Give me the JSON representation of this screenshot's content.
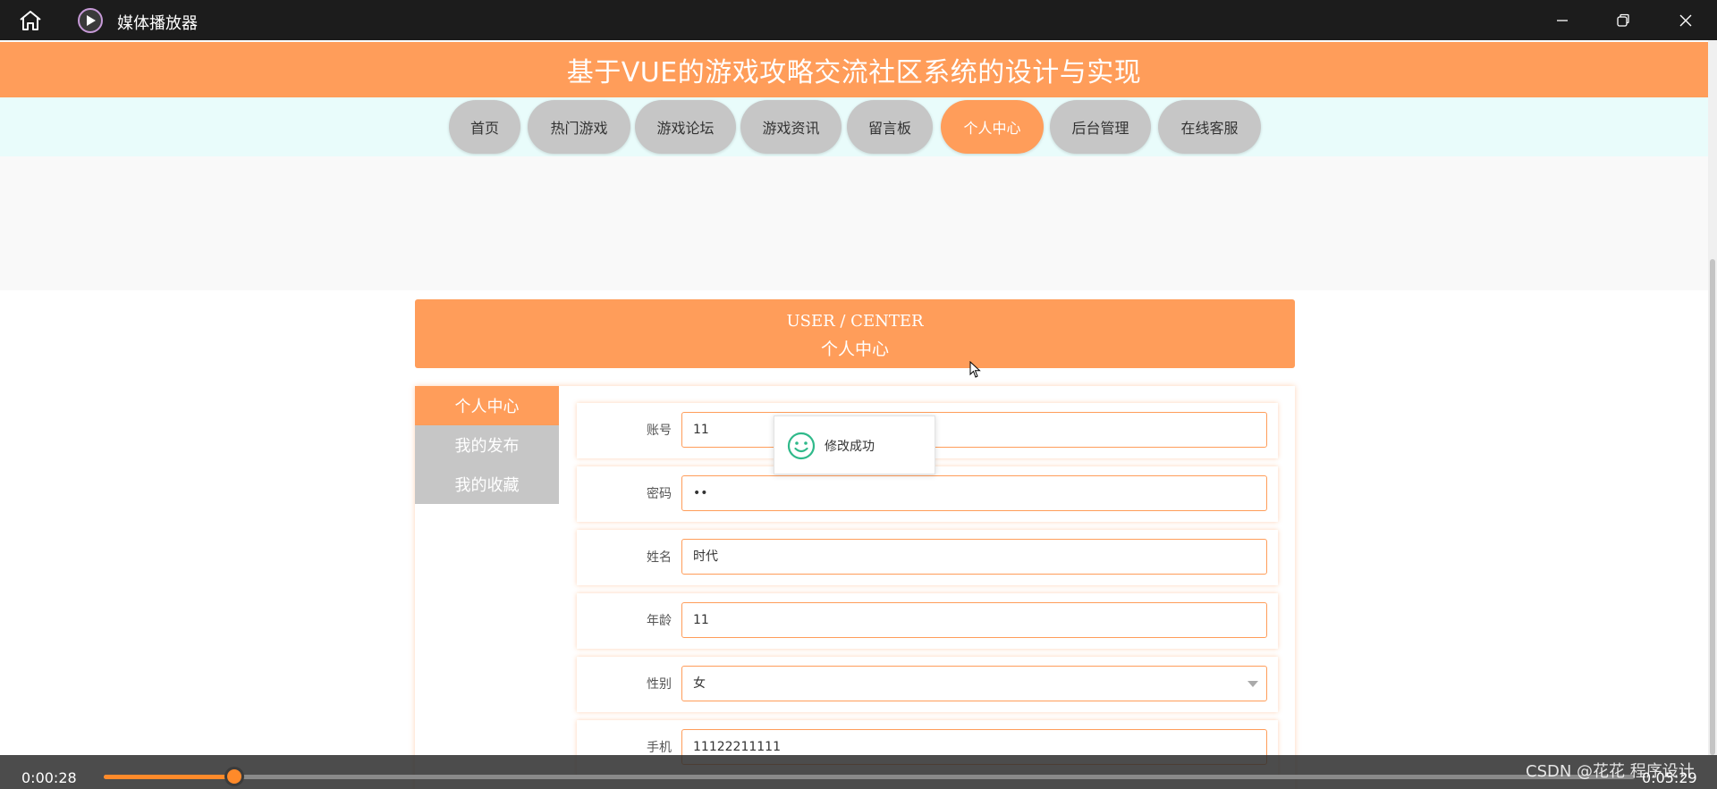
{
  "window": {
    "title": "媒体播放器",
    "icons": {
      "home": "home-icon",
      "app": "play-circle-icon",
      "minimize": "minimize-icon",
      "maximize": "restore-icon",
      "close": "close-icon"
    }
  },
  "site": {
    "title": "基于VUE的游戏攻略交流社区系统的设计与实现",
    "accent_color": "#ff9d5a"
  },
  "nav": {
    "items": [
      {
        "label": "首页"
      },
      {
        "label": "热门游戏"
      },
      {
        "label": "游戏论坛"
      },
      {
        "label": "游戏资讯"
      },
      {
        "label": "留言板"
      },
      {
        "label": "个人中心"
      },
      {
        "label": "后台管理"
      },
      {
        "label": "在线客服"
      }
    ],
    "active": "个人中心"
  },
  "user_center": {
    "title_en": "USER / CENTER",
    "title_cn": "个人中心"
  },
  "sidebar": {
    "items": [
      {
        "label": "个人中心"
      },
      {
        "label": "我的发布"
      },
      {
        "label": "我的收藏"
      }
    ],
    "active": "个人中心"
  },
  "form": {
    "fields": [
      {
        "label": "账号",
        "value": "11"
      },
      {
        "label": "密码",
        "value": "••"
      },
      {
        "label": "姓名",
        "value": "时代"
      },
      {
        "label": "年龄",
        "value": "11"
      },
      {
        "label": "性别",
        "value": "女"
      },
      {
        "label": "手机",
        "value": "11122211111"
      }
    ]
  },
  "toast": {
    "message": "修改成功",
    "icon": "smile-icon"
  },
  "player": {
    "current_time": "0:00:28",
    "total_time": "0:05:29",
    "progress_fraction": 0.085
  },
  "watermark": "CSDN @花花 程序设计"
}
